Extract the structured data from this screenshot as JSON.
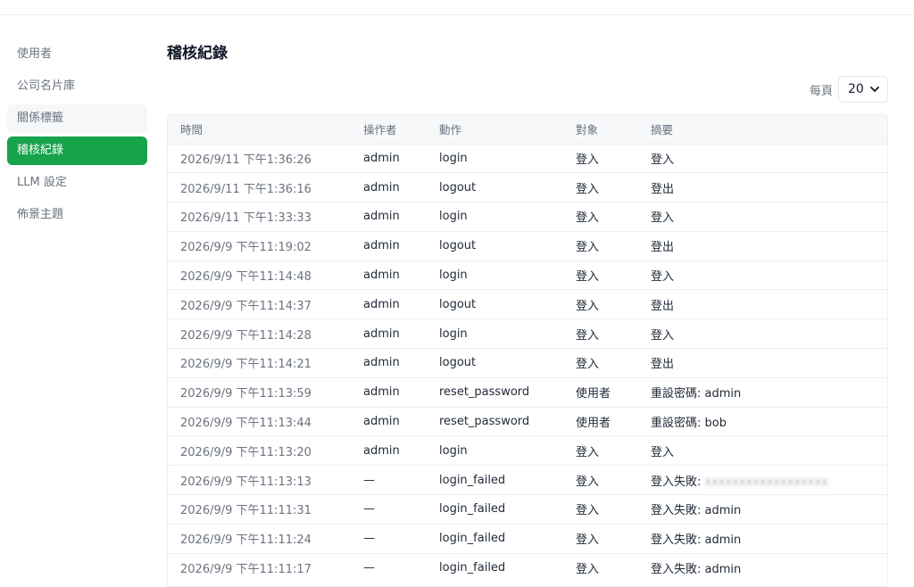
{
  "sidebar": {
    "items": [
      {
        "label": "使用者"
      },
      {
        "label": "公司名片庫"
      },
      {
        "label": "關係標籤"
      },
      {
        "label": "稽核紀錄"
      },
      {
        "label": "LLM 設定"
      },
      {
        "label": "佈景主題"
      }
    ],
    "active_index": 3
  },
  "main": {
    "title": "稽核紀錄",
    "per_page_label": "每頁",
    "per_page_value": "20"
  },
  "table": {
    "headers": [
      "時間",
      "操作者",
      "動作",
      "對象",
      "摘要"
    ],
    "rows": [
      {
        "time": "2026/9/11 下午1:36:26",
        "actor": "admin",
        "action": "login",
        "target": "登入",
        "summary": "登入"
      },
      {
        "time": "2026/9/11 下午1:36:16",
        "actor": "admin",
        "action": "logout",
        "target": "登入",
        "summary": "登出"
      },
      {
        "time": "2026/9/11 下午1:33:33",
        "actor": "admin",
        "action": "login",
        "target": "登入",
        "summary": "登入"
      },
      {
        "time": "2026/9/9 下午11:19:02",
        "actor": "admin",
        "action": "logout",
        "target": "登入",
        "summary": "登出"
      },
      {
        "time": "2026/9/9 下午11:14:48",
        "actor": "admin",
        "action": "login",
        "target": "登入",
        "summary": "登入"
      },
      {
        "time": "2026/9/9 下午11:14:37",
        "actor": "admin",
        "action": "logout",
        "target": "登入",
        "summary": "登出"
      },
      {
        "time": "2026/9/9 下午11:14:28",
        "actor": "admin",
        "action": "login",
        "target": "登入",
        "summary": "登入"
      },
      {
        "time": "2026/9/9 下午11:14:21",
        "actor": "admin",
        "action": "logout",
        "target": "登入",
        "summary": "登出"
      },
      {
        "time": "2026/9/9 下午11:13:59",
        "actor": "admin",
        "action": "reset_password",
        "target": "使用者",
        "summary": "重設密碼: admin"
      },
      {
        "time": "2026/9/9 下午11:13:44",
        "actor": "admin",
        "action": "reset_password",
        "target": "使用者",
        "summary": "重設密碼: bob"
      },
      {
        "time": "2026/9/9 下午11:13:20",
        "actor": "admin",
        "action": "login",
        "target": "登入",
        "summary": "登入"
      },
      {
        "time": "2026/9/9 下午11:13:13",
        "actor": "—",
        "action": "login_failed",
        "target": "登入",
        "summary": "登入失敗:",
        "summary_redacted": true
      },
      {
        "time": "2026/9/9 下午11:11:31",
        "actor": "—",
        "action": "login_failed",
        "target": "登入",
        "summary": "登入失敗: admin"
      },
      {
        "time": "2026/9/9 下午11:11:24",
        "actor": "—",
        "action": "login_failed",
        "target": "登入",
        "summary": "登入失敗: admin"
      },
      {
        "time": "2026/9/9 下午11:11:17",
        "actor": "—",
        "action": "login_failed",
        "target": "登入",
        "summary": "登入失敗: admin"
      }
    ]
  },
  "colors": {
    "accent": "#16a34a",
    "muted_text": "#6b7280",
    "border": "#eceef1"
  }
}
